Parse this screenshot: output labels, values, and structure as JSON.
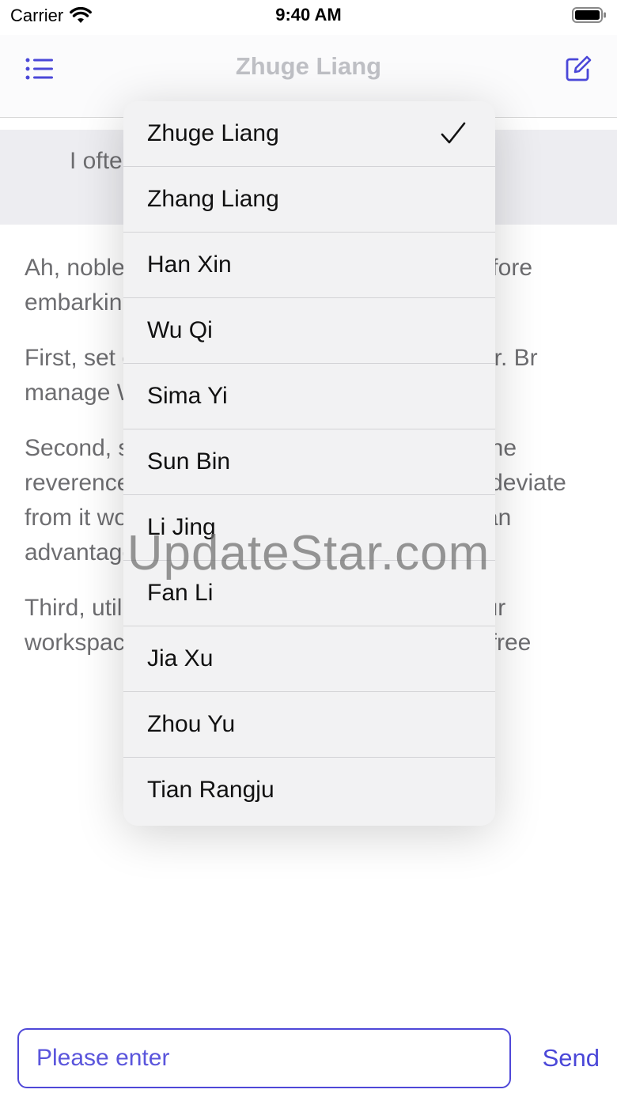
{
  "status_bar": {
    "carrier": "Carrier",
    "time": "9:40 AM"
  },
  "nav": {
    "title": "Zhuge Liang",
    "menu_icon": "list-icon",
    "compose_icon": "compose-icon",
    "title_color": "#bfc0c5",
    "accent_color": "#4a47d8"
  },
  "prompt": {
    "text": "I ofte                                                                    ways to help"
  },
  "response": {
    "paragraphs": [
      "Ah, noble                                                         ion, we must firs                                                     e the strategis                                                     before embarkin                                                    n arises when the                                                       and when the",
      "First, set                                                              e the stars tha destinati                                                         n shall falter. Br manage                                                             Wall was built",
      "Second,                                                           s in a military c                                                        of the day to ea                                                        ith the reverence and strictness of a battle plan. To deviate from it would be akin to allowing the enemy an advantage.",
      "Third, utilize the concept of \"feng shui\" in your workspace. Let the area where you work be free"
    ]
  },
  "dropdown": {
    "selected": "Zhuge Liang",
    "check_icon": "checkmark-icon",
    "items": [
      "Zhuge Liang",
      "Zhang Liang",
      "Han Xin",
      "Wu Qi",
      "Sima Yi",
      "Sun Bin",
      "Li Jing",
      "Fan Li",
      "Jia Xu",
      "Zhou Yu",
      "Tian Rangju"
    ]
  },
  "watermark": "UpdateStar.com",
  "input": {
    "placeholder": "Please enter",
    "send_label": "Send"
  }
}
